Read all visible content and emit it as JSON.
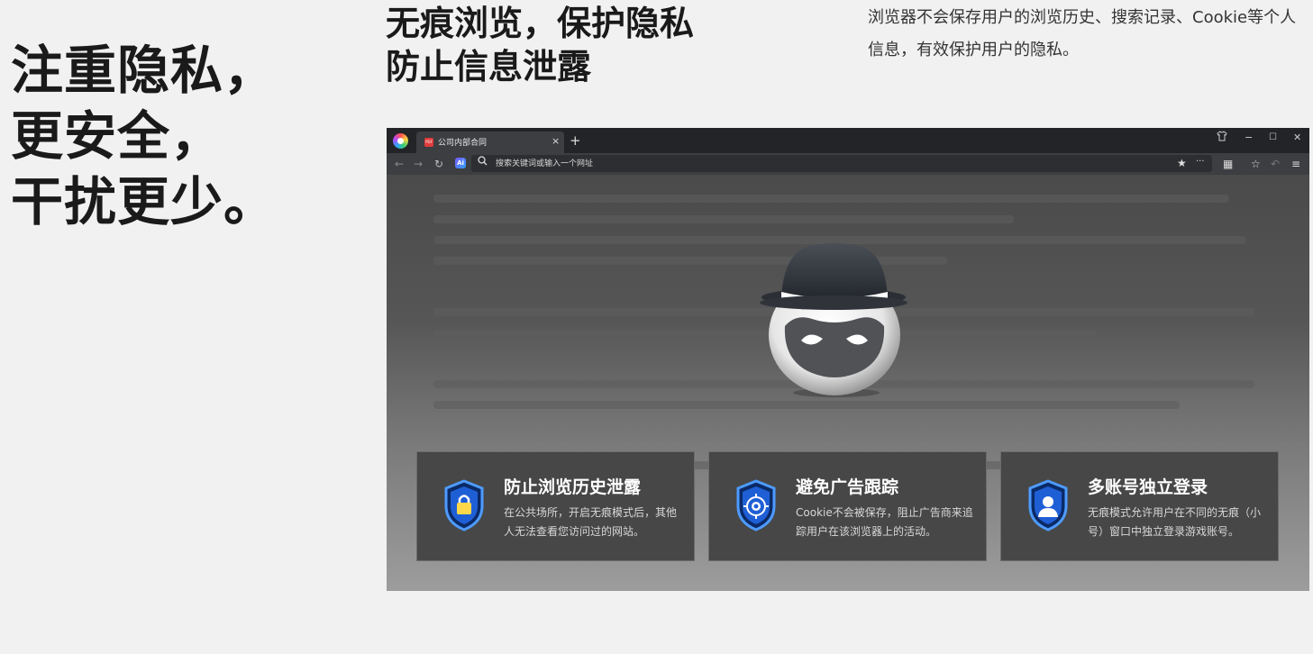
{
  "hero": {
    "line1": "注重隐私，",
    "line2": "更安全，",
    "line3": "干扰更少。"
  },
  "section": {
    "title_line1": "无痕浏览，保护隐私",
    "title_line2": "防止信息泄露",
    "description": "浏览器不会保存用户的浏览历史、搜索记录、Cookie等个人信息，有效保护用户的隐私。"
  },
  "browser": {
    "tab": {
      "badge": "PDF",
      "title": "公司内部合同",
      "close": "×"
    },
    "new_tab": "+",
    "window_controls": {
      "skin": "👕",
      "minimize": "−",
      "maximize": "☐",
      "close": "✕"
    },
    "toolbar": {
      "back": "←",
      "forward": "→",
      "refresh": "↻",
      "ai": "Ai",
      "search_icon": "🔍",
      "address_placeholder": "搜索关键词或输入一个网址",
      "star": "★",
      "more": "···",
      "apps": "▦",
      "favorites": "☆",
      "undo": "↶",
      "menu": "≡"
    },
    "cards": [
      {
        "title": "防止浏览历史泄露",
        "desc": "在公共场所，开启无痕模式后，其他人无法查看您访问过的网站。",
        "icon": "lock-shield-icon"
      },
      {
        "title": "避免广告跟踪",
        "desc": "Cookie不会被保存，阻止广告商来追踪用户在该浏览器上的活动。",
        "icon": "target-shield-icon"
      },
      {
        "title": "多账号独立登录",
        "desc": "无痕模式允许用户在不同的无痕（小号）窗口中独立登录游戏账号。",
        "icon": "user-shield-icon"
      }
    ]
  },
  "colors": {
    "page_bg": "#f1f1f1",
    "text_dark": "#1a1a1a",
    "browser_chrome": "#232427",
    "toolbar_bg": "#3d3e42",
    "card_bg": "#474747",
    "accent_blue": "#2f7bf0"
  }
}
